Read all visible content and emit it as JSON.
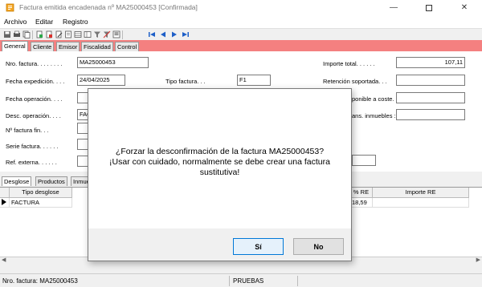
{
  "window": {
    "title": "Factura emitida encadenada nº MA25000453 [Confirmada]",
    "controls": [
      "minimize",
      "maximize",
      "close"
    ]
  },
  "menu": [
    "Archivo",
    "Editar",
    "Registro"
  ],
  "tabs": [
    "General",
    "Cliente",
    "Emisor",
    "Fiscalidad",
    "Control"
  ],
  "form": {
    "nro_factura_label": "Nro. factura. . . . . . . .",
    "nro_factura_value": "MA25000453",
    "fecha_expedicion_label": "Fecha expedición. . . .",
    "fecha_expedicion_value": "24/04/2025",
    "tipo_factura_label": "Tipo factura. . .",
    "tipo_factura_value": "F1",
    "fecha_operacion_label": "Fecha operación. . . .",
    "desc_operacion_label": "Desc. operación. . . .",
    "desc_operacion_value": "FAC",
    "nro_factura_fin_label": "Nº factura fin. . .",
    "serie_factura_label": "Serie factura. . . . . .",
    "ref_externa_label": "Ref. externa. . . . . .",
    "importe_total_label": "Importe total. . . . . .",
    "importe_total_value": "107,11",
    "retencion_label": "Retención soportada. . .",
    "deducible_label": "ponible a coste. . .",
    "arrendamiento_label": "ans. inmuebles :"
  },
  "bottom_tabs": [
    "Desglose",
    "Productos",
    "Inmue"
  ],
  "grid": {
    "headers": [
      "Tipo desglose",
      "% RE",
      "Importe RE"
    ],
    "row": {
      "tipo": "FACTURA",
      "partial_value": "18,59"
    }
  },
  "status": {
    "factura": "Nro. factura: MA25000453",
    "entorno": "PRUEBAS"
  },
  "dialog": {
    "line1": "¿Forzar la desconfirmación de la factura MA25000453?",
    "line2": "¡Usar con cuidado, normalmente se debe crear una factura",
    "line3": "sustitutiva!",
    "yes_label": "Sí",
    "no_label": "No"
  },
  "colors": {
    "tabstrip_bg": "#f48080",
    "dialog_default_border": "#0078d7",
    "nav_arrows": "#1e5fc8"
  }
}
